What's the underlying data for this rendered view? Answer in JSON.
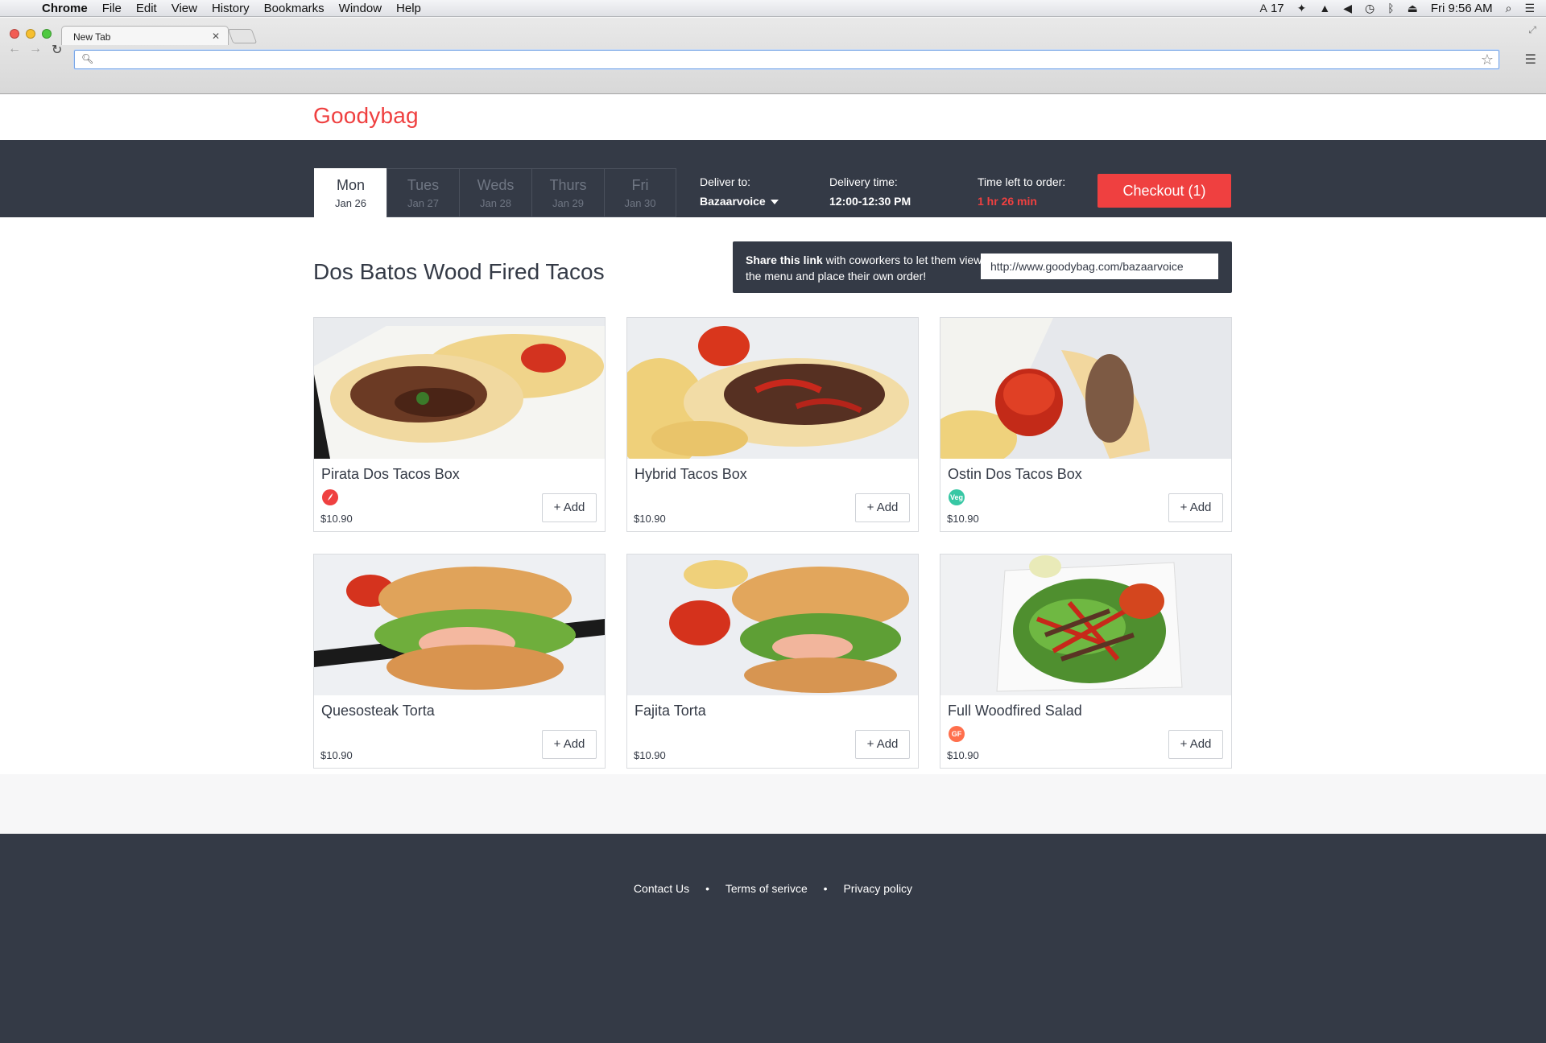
{
  "menubar": {
    "app": "Chrome",
    "items": [
      "File",
      "Edit",
      "View",
      "History",
      "Bookmarks",
      "Window",
      "Help"
    ],
    "adobe_count": "17",
    "clock": "Fri 9:56 AM"
  },
  "browser": {
    "tab_title": "New Tab",
    "omnibox_value": ""
  },
  "site": {
    "logo": "Goodybag",
    "days": [
      {
        "name": "Mon",
        "date": "Jan 26"
      },
      {
        "name": "Tues",
        "date": "Jan 27"
      },
      {
        "name": "Weds",
        "date": "Jan 28"
      },
      {
        "name": "Thurs",
        "date": "Jan 29"
      },
      {
        "name": "Fri",
        "date": "Jan 30"
      }
    ],
    "deliver_to_label": "Deliver to:",
    "deliver_to_value": "Bazaarvoice",
    "delivery_time_label": "Delivery time:",
    "delivery_time_value": "12:00-12:30 PM",
    "time_left_label": "Time left to order:",
    "time_left_value": "1 hr 26 min",
    "checkout_label": "Checkout (1)",
    "accent_color": "#ef4040",
    "band_color": "#343a46"
  },
  "restaurant": {
    "title": "Dos Batos Wood Fired Tacos",
    "share_bold": "Share this link",
    "share_text": " with coworkers to let them view the menu and place their own order!",
    "share_url": "http://www.goodybag.com/bazaarvoice"
  },
  "menu": [
    {
      "name": "Pirata Dos Tacos Box",
      "price": "$10.90",
      "badge": "",
      "badge_icon": "chili-pepper-icon",
      "add": "+ Add"
    },
    {
      "name": "Hybrid Tacos Box",
      "price": "$10.90",
      "badge": "",
      "badge_icon": "",
      "add": "+ Add"
    },
    {
      "name": "Ostin Dos Tacos Box",
      "price": "$10.90",
      "badge": "Veg",
      "badge_icon": "veg-icon",
      "add": "+ Add"
    },
    {
      "name": "Quesosteak Torta",
      "price": "$10.90",
      "badge": "",
      "badge_icon": "",
      "add": "+ Add"
    },
    {
      "name": "Fajita Torta",
      "price": "$10.90",
      "badge": "",
      "badge_icon": "",
      "add": "+ Add"
    },
    {
      "name": "Full Woodfired Salad",
      "price": "$10.90",
      "badge": "GF",
      "badge_icon": "gluten-free-icon",
      "add": "+ Add"
    }
  ],
  "footer": {
    "links": [
      "Contact Us",
      "Terms of serivce",
      "Privacy policy"
    ]
  }
}
